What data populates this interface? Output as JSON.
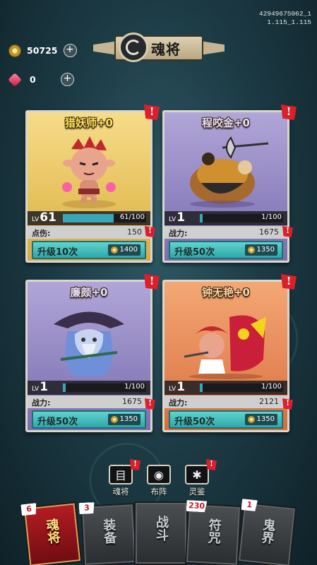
{
  "build": {
    "line1": "42949675062_1",
    "line2": "1.115_1.115"
  },
  "header": {
    "title": "魂将",
    "emblem_icon": "soul-emblem-icon"
  },
  "currency": {
    "coins": {
      "icon": "coin-icon",
      "value": "50725"
    },
    "gems": {
      "icon": "gem-icon",
      "value": "0"
    },
    "plus_label": "+"
  },
  "cards": [
    {
      "name": "猎妖师+0",
      "theme": "gold",
      "lv_prefix": "LV",
      "level": "61",
      "exp": "61/100",
      "exp_fraction": 0.61,
      "stat_label": "点伤:",
      "stat_value": "150",
      "upgrade_label": "升级10次",
      "cost": "1400"
    },
    {
      "name": "程咬金+0",
      "theme": "purple",
      "lv_prefix": "LV",
      "level": "1",
      "exp": "1/100",
      "exp_fraction": 0.01,
      "stat_label": "战力:",
      "stat_value": "1675",
      "upgrade_label": "升级50次",
      "cost": "1350"
    },
    {
      "name": "廉颇+0",
      "theme": "purple",
      "lv_prefix": "LV",
      "level": "1",
      "exp": "1/100",
      "exp_fraction": 0.01,
      "stat_label": "战力:",
      "stat_value": "1675",
      "upgrade_label": "升级50次",
      "cost": "1350"
    },
    {
      "name": "钟无艳+0",
      "theme": "orange",
      "lv_prefix": "LV",
      "level": "1",
      "exp": "1/100",
      "exp_fraction": 0.01,
      "stat_label": "战力:",
      "stat_value": "2121",
      "upgrade_label": "升级50次",
      "cost": "1350"
    }
  ],
  "alert_glyph": "!",
  "mini_buttons": [
    {
      "label": "魂将",
      "icon": "book-icon",
      "glyph": "目"
    },
    {
      "label": "布阵",
      "icon": "formation-icon",
      "glyph": "◉"
    },
    {
      "label": "灵鉴",
      "icon": "spirit-mirror-icon",
      "glyph": "✱"
    }
  ],
  "nav": [
    {
      "label": "魂将",
      "badge": "6",
      "active": true
    },
    {
      "label": "装备",
      "badge": "3",
      "active": false
    },
    {
      "label": "战斗",
      "badge": "",
      "active": false
    },
    {
      "label": "符咒",
      "badge": "230",
      "active": false
    },
    {
      "label": "鬼界",
      "badge": "1",
      "active": false
    }
  ],
  "colors": {
    "accent_teal": "#3aa6b8",
    "alert_red": "#d9202b",
    "nav_active": "#b51c24"
  }
}
